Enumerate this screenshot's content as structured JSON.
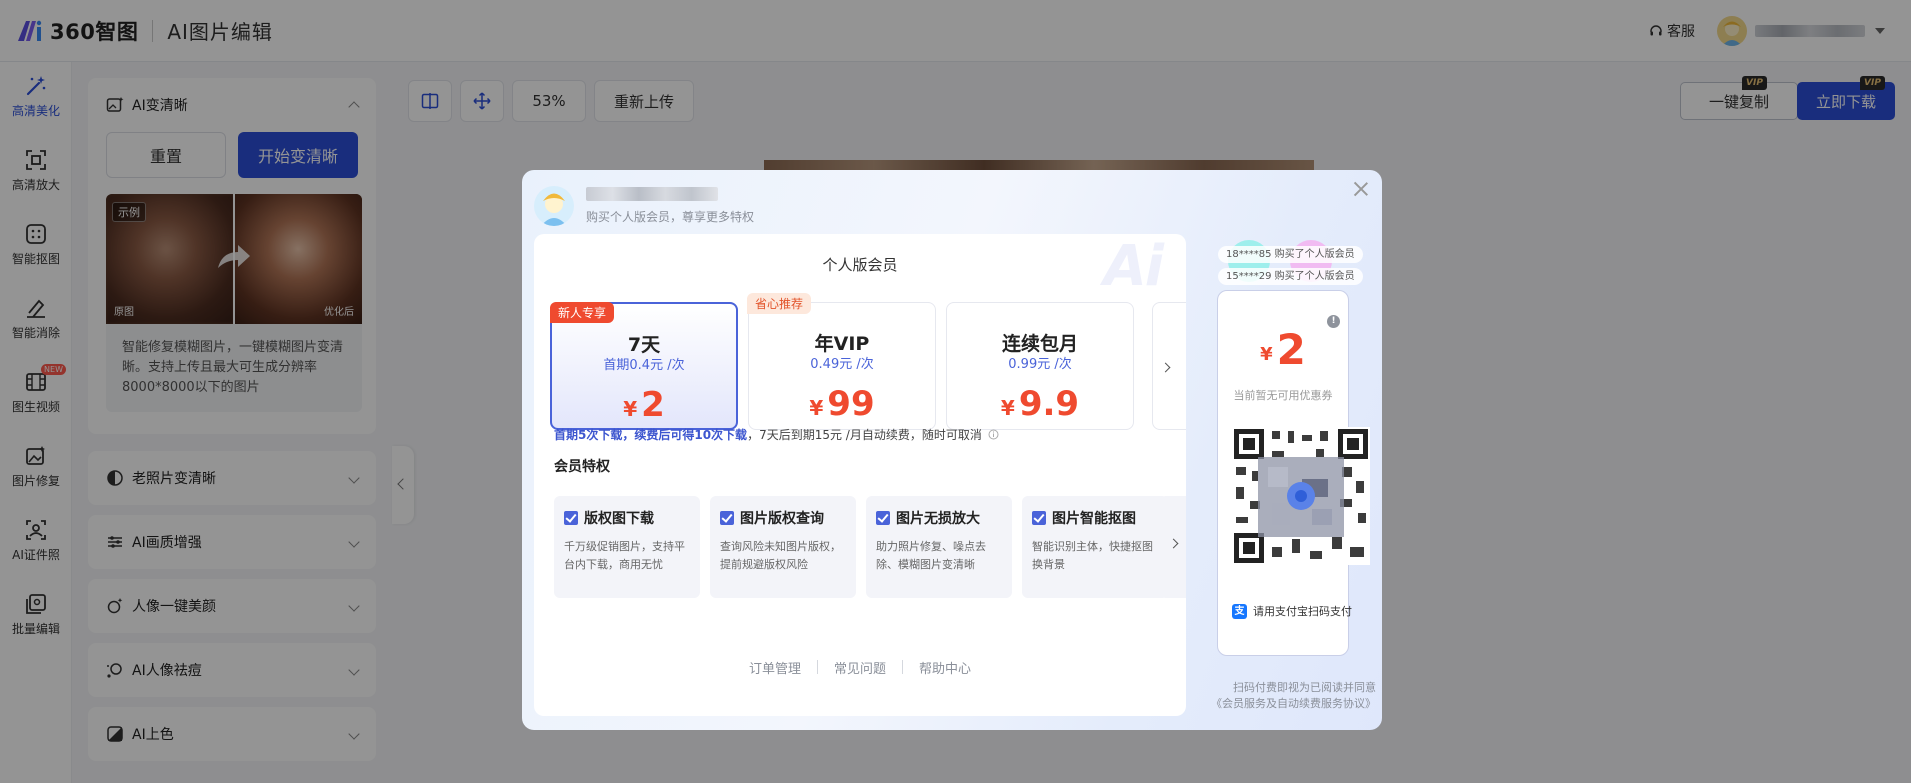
{
  "header": {
    "brand": "360智图",
    "app_title": "AI图片编辑",
    "service_label": "客服"
  },
  "rail": [
    {
      "label": "高清美化",
      "icon": "magic-wand-icon",
      "active": true
    },
    {
      "label": "高清放大",
      "icon": "scan-enlarge-icon"
    },
    {
      "label": "智能抠图",
      "icon": "cutout-icon"
    },
    {
      "label": "智能消除",
      "icon": "eraser-icon"
    },
    {
      "label": "图生视频",
      "icon": "video-icon",
      "badge": "NEW"
    },
    {
      "label": "图片修复",
      "icon": "image-repair-icon"
    },
    {
      "label": "AI证件照",
      "icon": "id-photo-icon"
    },
    {
      "label": "批量编辑",
      "icon": "batch-icon"
    }
  ],
  "panel": {
    "active_tool": {
      "title": "AI变清晰",
      "reset_label": "重置",
      "start_label": "开始变清晰",
      "example_tag": "示例",
      "before_label": "原图",
      "after_label": "优化后",
      "description": "智能修复模糊图片，一键模糊图片变清晰。支持上传且最大可生成分辨率8000*8000以下的图片"
    },
    "tools": [
      {
        "title": "老照片变清晰"
      },
      {
        "title": "AI画质增强"
      },
      {
        "title": "人像一键美颜"
      },
      {
        "title": "AI人像祛痘"
      },
      {
        "title": "AI上色"
      }
    ]
  },
  "toolbar": {
    "zoom": "53%",
    "reupload_label": "重新上传",
    "copy_label": "一键复制",
    "download_label": "立即下载",
    "vip_label": "VIP"
  },
  "modal": {
    "subtitle": "购买个人版会员，尊享更多特权",
    "title": "个人版会员",
    "plans": [
      {
        "name": "7天",
        "unit_price": "首期0.4元 /次",
        "price": "2",
        "currency": "¥",
        "tag": "新人专享",
        "selected": true
      },
      {
        "name": "年VIP",
        "unit_price": "0.49元 /次",
        "price": "99",
        "currency": "¥",
        "tag": "省心推荐"
      },
      {
        "name": "连续包月",
        "unit_price": "0.99元 /次",
        "price": "9.9",
        "currency": "¥"
      }
    ],
    "terms": {
      "part1": "首期5次下载，",
      "part2": "续费后可得10次下载",
      "part3": "，7天后到期15元 /月自动续费，随时可取消"
    },
    "perks_title": "会员特权",
    "perks": [
      {
        "title": "版权图下载",
        "desc": "千万级促销图片，支持平台内下载，商用无忧"
      },
      {
        "title": "图片版权查询",
        "desc": "查询风险未知图片版权，提前规避版权风险"
      },
      {
        "title": "图片无损放大",
        "desc": "助力照片修复、噪点去除、模糊图片变清晰"
      },
      {
        "title": "图片智能抠图",
        "desc": "智能识别主体，快捷抠图换背景"
      }
    ],
    "links": [
      "订单管理",
      "常见问题",
      "帮助中心"
    ],
    "purchases": [
      "18****85 购买了个人版会员",
      "15****29 购买了个人版会员"
    ],
    "pay": {
      "currency": "¥",
      "amount": "2",
      "coupon_note": "当前暂无可用优惠券",
      "method": "请用支付宝扫码支付",
      "agreement_line1": "扫码付费即视为已阅读并同意",
      "agreement_line2": "《会员服务及自动续费服务协议》"
    }
  }
}
